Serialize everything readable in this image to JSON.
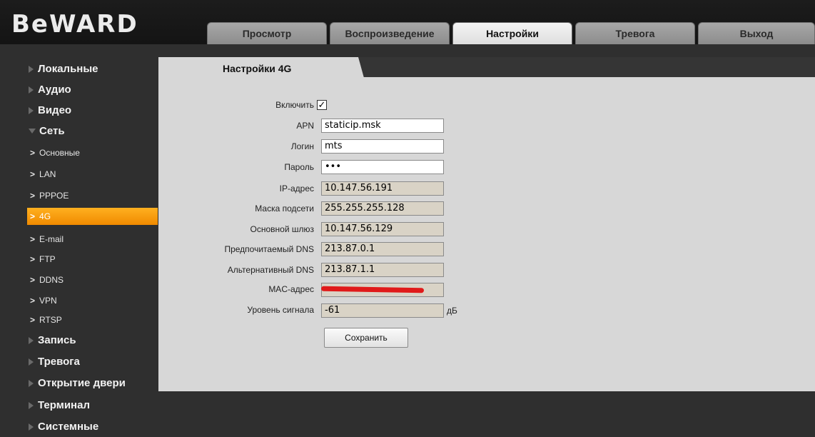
{
  "header": {
    "logo": "BeWARD",
    "tabs": [
      {
        "label": "Просмотр",
        "active": false
      },
      {
        "label": "Воспроизведение",
        "active": false
      },
      {
        "label": "Настройки",
        "active": true
      },
      {
        "label": "Тревога",
        "active": false
      },
      {
        "label": "Выход",
        "active": false
      }
    ]
  },
  "sidebar": {
    "items": [
      {
        "label": "Локальные",
        "level": "top",
        "icon": "triangle-right-icon"
      },
      {
        "label": "Аудио",
        "level": "top",
        "icon": "triangle-right-icon"
      },
      {
        "label": "Видео",
        "level": "top",
        "icon": "triangle-right-icon"
      },
      {
        "label": "Сеть",
        "level": "top",
        "icon": "triangle-down-icon",
        "expanded": true
      },
      {
        "label": "Основные",
        "level": "sub",
        "icon": "chevron-right-icon"
      },
      {
        "label": "LAN",
        "level": "sub",
        "icon": "chevron-right-icon"
      },
      {
        "label": "PPPOE",
        "level": "sub",
        "icon": "chevron-right-icon"
      },
      {
        "label": "4G",
        "level": "sub",
        "icon": "chevron-right-icon",
        "active": true
      },
      {
        "label": "E-mail",
        "level": "sub",
        "icon": "chevron-right-icon"
      },
      {
        "label": "FTP",
        "level": "sub",
        "icon": "chevron-right-icon"
      },
      {
        "label": "DDNS",
        "level": "sub",
        "icon": "chevron-right-icon"
      },
      {
        "label": "VPN",
        "level": "sub",
        "icon": "chevron-right-icon"
      },
      {
        "label": "RTSP",
        "level": "sub",
        "icon": "chevron-right-icon"
      },
      {
        "label": "Запись",
        "level": "top",
        "icon": "triangle-right-icon"
      },
      {
        "label": "Тревога",
        "level": "top",
        "icon": "triangle-right-icon"
      },
      {
        "label": "Открытие двери",
        "level": "top",
        "icon": "triangle-right-icon"
      },
      {
        "label": "Терминал",
        "level": "top",
        "icon": "triangle-right-icon"
      },
      {
        "label": "Системные",
        "level": "top",
        "icon": "triangle-right-icon"
      }
    ]
  },
  "content": {
    "section_title": "Настройки 4G",
    "enable": {
      "label": "Включить",
      "checked": true
    },
    "fields": {
      "apn": {
        "label": "APN",
        "value": "staticip.msk"
      },
      "login": {
        "label": "Логин",
        "value": "mts"
      },
      "password": {
        "label": "Пароль",
        "value": "•••"
      },
      "ip": {
        "label": "IP-адрес",
        "value": "10.147.56.191"
      },
      "mask": {
        "label": "Маска подсети",
        "value": "255.255.255.128"
      },
      "gateway": {
        "label": "Основной шлюз",
        "value": "10.147.56.129"
      },
      "dns1": {
        "label": "Предпочитаемый DNS",
        "value": "213.87.0.1"
      },
      "dns2": {
        "label": "Альтернативный DNS",
        "value": "213.87.1.1"
      },
      "mac": {
        "label": "MAC-адрес",
        "value": ""
      },
      "signal": {
        "label": "Уровень сигнала",
        "value": "-61",
        "unit": "дБ"
      }
    },
    "save_label": "Сохранить"
  },
  "colors": {
    "background": "#2f2f2f",
    "panel": "#d7d7d7",
    "active_item": "#f7a020",
    "readonly_field": "#d9d3c6",
    "redaction": "#e01a1a"
  }
}
